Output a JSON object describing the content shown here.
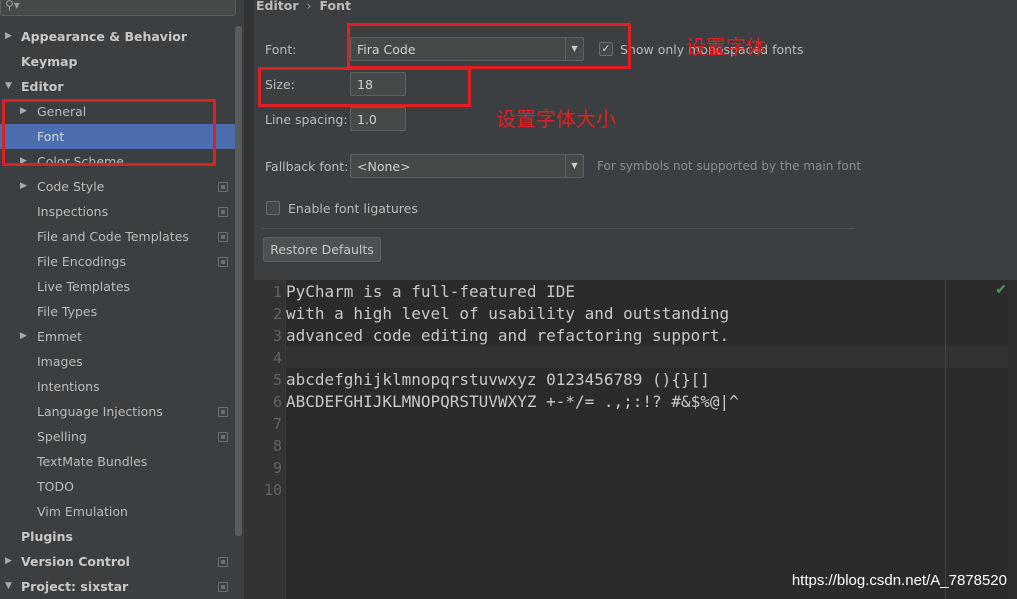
{
  "breadcrumb": {
    "parent": "Editor",
    "separator": "›",
    "current": "Font"
  },
  "sidebar": {
    "items": [
      {
        "label": "Appearance & Behavior",
        "bold": true,
        "arrow": "▶",
        "level": 0,
        "has_icon": false
      },
      {
        "label": "Keymap",
        "bold": true,
        "arrow": "",
        "level": 0,
        "has_icon": false
      },
      {
        "label": "Editor",
        "bold": true,
        "arrow": "▼",
        "level": 0,
        "has_icon": false
      },
      {
        "label": "General",
        "bold": false,
        "arrow": "▶",
        "level": 1,
        "has_icon": false
      },
      {
        "label": "Font",
        "bold": false,
        "arrow": "",
        "level": 1,
        "has_icon": false,
        "selected": true
      },
      {
        "label": "Color Scheme",
        "bold": false,
        "arrow": "▶",
        "level": 1,
        "has_icon": false
      },
      {
        "label": "Code Style",
        "bold": false,
        "arrow": "▶",
        "level": 1,
        "has_icon": true
      },
      {
        "label": "Inspections",
        "bold": false,
        "arrow": "",
        "level": 1,
        "has_icon": true
      },
      {
        "label": "File and Code Templates",
        "bold": false,
        "arrow": "",
        "level": 1,
        "has_icon": true
      },
      {
        "label": "File Encodings",
        "bold": false,
        "arrow": "",
        "level": 1,
        "has_icon": true
      },
      {
        "label": "Live Templates",
        "bold": false,
        "arrow": "",
        "level": 1,
        "has_icon": false
      },
      {
        "label": "File Types",
        "bold": false,
        "arrow": "",
        "level": 1,
        "has_icon": false
      },
      {
        "label": "Emmet",
        "bold": false,
        "arrow": "▶",
        "level": 1,
        "has_icon": false
      },
      {
        "label": "Images",
        "bold": false,
        "arrow": "",
        "level": 1,
        "has_icon": false
      },
      {
        "label": "Intentions",
        "bold": false,
        "arrow": "",
        "level": 1,
        "has_icon": false
      },
      {
        "label": "Language Injections",
        "bold": false,
        "arrow": "",
        "level": 1,
        "has_icon": true
      },
      {
        "label": "Spelling",
        "bold": false,
        "arrow": "",
        "level": 1,
        "has_icon": true
      },
      {
        "label": "TextMate Bundles",
        "bold": false,
        "arrow": "",
        "level": 1,
        "has_icon": false
      },
      {
        "label": "TODO",
        "bold": false,
        "arrow": "",
        "level": 1,
        "has_icon": false
      },
      {
        "label": "Vim Emulation",
        "bold": false,
        "arrow": "",
        "level": 1,
        "has_icon": false
      },
      {
        "label": "Plugins",
        "bold": true,
        "arrow": "",
        "level": 0,
        "has_icon": false
      },
      {
        "label": "Version Control",
        "bold": true,
        "arrow": "▶",
        "level": 0,
        "has_icon": true
      },
      {
        "label": "Project: sixstar",
        "bold": true,
        "arrow": "▼",
        "level": 0,
        "has_icon": true
      }
    ]
  },
  "font_settings": {
    "font_label": "Font:",
    "font_value": "Fira Code",
    "monospaced_only_label": "Show only monospaced fonts",
    "monospaced_only_checked": true,
    "size_label": "Size:",
    "size_value": "18",
    "line_spacing_label": "Line spacing:",
    "line_spacing_value": "1.0",
    "fallback_label": "Fallback font:",
    "fallback_value": "<None>",
    "fallback_hint": "For symbols not supported by the main font",
    "ligatures_label": "Enable font ligatures",
    "ligatures_checked": false,
    "restore_button": "Restore Defaults"
  },
  "preview": {
    "lines": [
      "PyCharm is a full-featured IDE",
      "with a high level of usability and outstanding",
      "advanced code editing and refactoring support.",
      "",
      "abcdefghijklmnopqrstuvwxyz 0123456789 (){}[]",
      "ABCDEFGHIJKLMNOPQRSTUVWXYZ +-*/= .,;:!? #&$%@|^",
      "",
      "",
      "",
      ""
    ],
    "line_numbers": [
      "1",
      "2",
      "3",
      "4",
      "5",
      "6",
      "7",
      "8",
      "9",
      "10"
    ]
  },
  "annotations": {
    "set_font": "设置字体",
    "set_font_size": "设置字体大小"
  },
  "watermark": "https://blog.csdn.net/A_7878520",
  "colors": {
    "selection": "#4b6eaf",
    "annotation_red": "#e02020",
    "editor_bg": "#2b2b2b"
  }
}
